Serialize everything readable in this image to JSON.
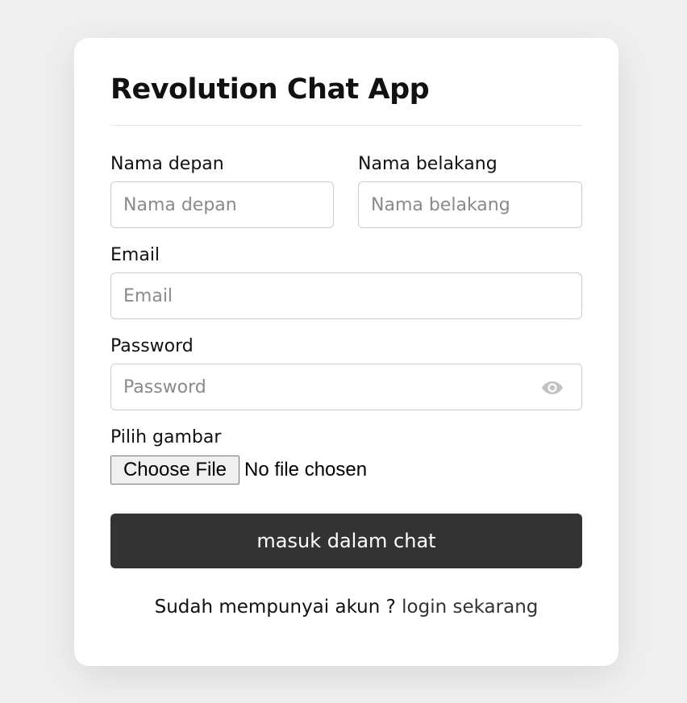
{
  "app": {
    "title": "Revolution Chat App"
  },
  "form": {
    "first_name": {
      "label": "Nama depan",
      "placeholder": "Nama depan",
      "value": ""
    },
    "last_name": {
      "label": "Nama belakang",
      "placeholder": "Nama belakang",
      "value": ""
    },
    "email": {
      "label": "Email",
      "placeholder": "Email",
      "value": ""
    },
    "password": {
      "label": "Password",
      "placeholder": "Password",
      "value": "",
      "toggle_icon": "eye-icon"
    },
    "image": {
      "label": "Pilih gambar",
      "button_label": "Choose File",
      "status": "No file chosen"
    },
    "submit_label": "masuk dalam chat"
  },
  "footer": {
    "prompt": "Sudah mempunyai akun ?",
    "link_label": "login sekarang"
  },
  "colors": {
    "page_bg": "#f0f0f0",
    "card_bg": "#ffffff",
    "button_bg": "#333333",
    "button_text": "#ffffff",
    "input_border": "#cccccc",
    "placeholder": "#8a8a8a"
  }
}
